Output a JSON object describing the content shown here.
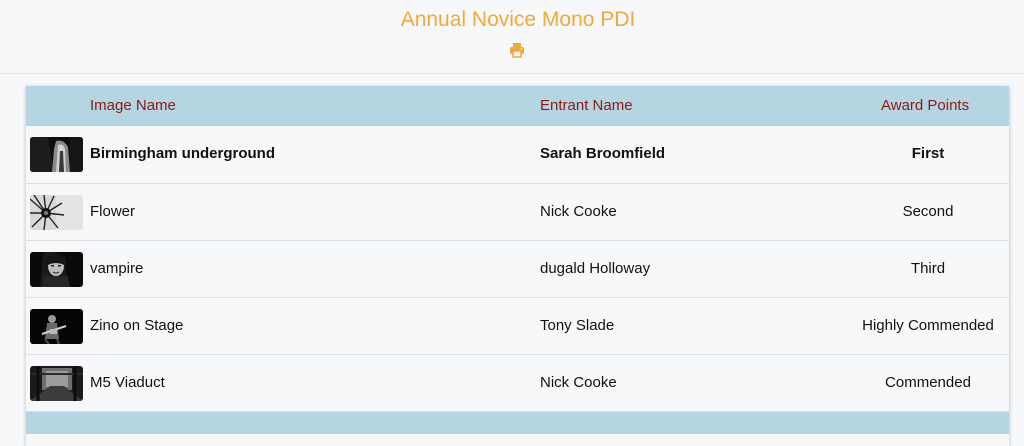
{
  "header": {
    "title": "Annual Novice Mono PDI",
    "print_icon": "print-icon"
  },
  "colors": {
    "title": "#f2a83a",
    "header_text": "#8b1a10",
    "table_header_bg": "#b5d5e3"
  },
  "table": {
    "columns": {
      "image": "Image Name",
      "entrant": "Entrant Name",
      "award": "Award Points"
    },
    "rows": [
      {
        "image": "Birmingham underground",
        "entrant": "Sarah Broomfield",
        "award": "First"
      },
      {
        "image": "Flower",
        "entrant": "Nick Cooke",
        "award": "Second"
      },
      {
        "image": "vampire",
        "entrant": "dugald Holloway",
        "award": "Third"
      },
      {
        "image": "Zino on Stage",
        "entrant": "Tony Slade",
        "award": "Highly Commended"
      },
      {
        "image": "M5 Viaduct",
        "entrant": "Nick Cooke",
        "award": "Commended"
      }
    ]
  }
}
